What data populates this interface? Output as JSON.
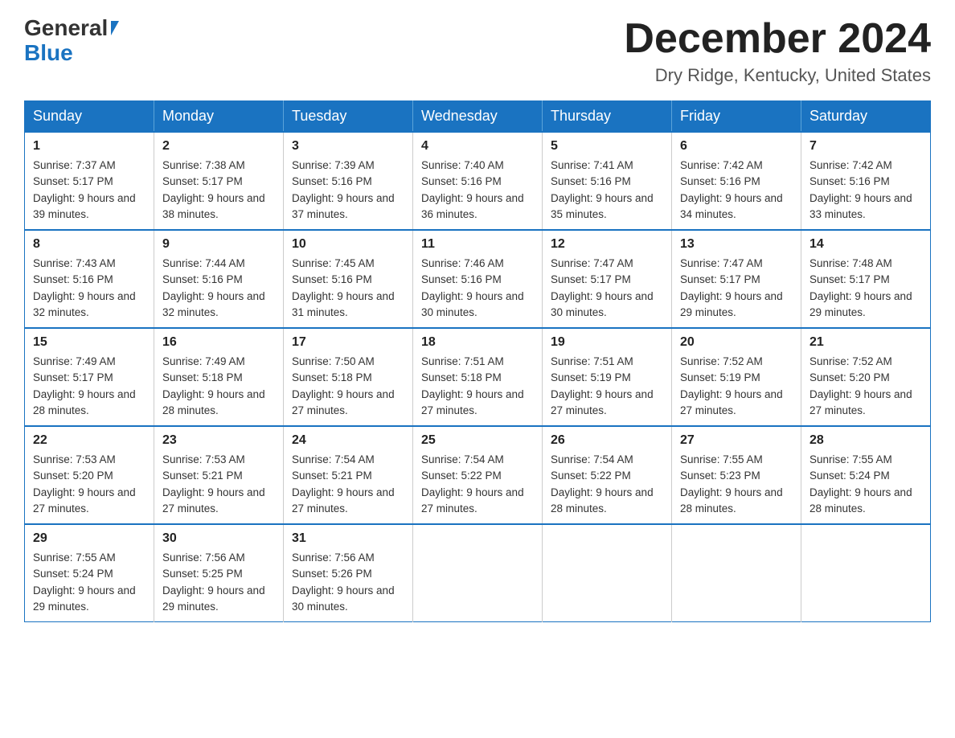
{
  "header": {
    "logo_general": "General",
    "logo_blue": "Blue",
    "month_title": "December 2024",
    "location": "Dry Ridge, Kentucky, United States"
  },
  "days_of_week": [
    "Sunday",
    "Monday",
    "Tuesday",
    "Wednesday",
    "Thursday",
    "Friday",
    "Saturday"
  ],
  "weeks": [
    [
      {
        "day": "1",
        "sunrise": "7:37 AM",
        "sunset": "5:17 PM",
        "daylight": "9 hours and 39 minutes."
      },
      {
        "day": "2",
        "sunrise": "7:38 AM",
        "sunset": "5:17 PM",
        "daylight": "9 hours and 38 minutes."
      },
      {
        "day": "3",
        "sunrise": "7:39 AM",
        "sunset": "5:16 PM",
        "daylight": "9 hours and 37 minutes."
      },
      {
        "day": "4",
        "sunrise": "7:40 AM",
        "sunset": "5:16 PM",
        "daylight": "9 hours and 36 minutes."
      },
      {
        "day": "5",
        "sunrise": "7:41 AM",
        "sunset": "5:16 PM",
        "daylight": "9 hours and 35 minutes."
      },
      {
        "day": "6",
        "sunrise": "7:42 AM",
        "sunset": "5:16 PM",
        "daylight": "9 hours and 34 minutes."
      },
      {
        "day": "7",
        "sunrise": "7:42 AM",
        "sunset": "5:16 PM",
        "daylight": "9 hours and 33 minutes."
      }
    ],
    [
      {
        "day": "8",
        "sunrise": "7:43 AM",
        "sunset": "5:16 PM",
        "daylight": "9 hours and 32 minutes."
      },
      {
        "day": "9",
        "sunrise": "7:44 AM",
        "sunset": "5:16 PM",
        "daylight": "9 hours and 32 minutes."
      },
      {
        "day": "10",
        "sunrise": "7:45 AM",
        "sunset": "5:16 PM",
        "daylight": "9 hours and 31 minutes."
      },
      {
        "day": "11",
        "sunrise": "7:46 AM",
        "sunset": "5:16 PM",
        "daylight": "9 hours and 30 minutes."
      },
      {
        "day": "12",
        "sunrise": "7:47 AM",
        "sunset": "5:17 PM",
        "daylight": "9 hours and 30 minutes."
      },
      {
        "day": "13",
        "sunrise": "7:47 AM",
        "sunset": "5:17 PM",
        "daylight": "9 hours and 29 minutes."
      },
      {
        "day": "14",
        "sunrise": "7:48 AM",
        "sunset": "5:17 PM",
        "daylight": "9 hours and 29 minutes."
      }
    ],
    [
      {
        "day": "15",
        "sunrise": "7:49 AM",
        "sunset": "5:17 PM",
        "daylight": "9 hours and 28 minutes."
      },
      {
        "day": "16",
        "sunrise": "7:49 AM",
        "sunset": "5:18 PM",
        "daylight": "9 hours and 28 minutes."
      },
      {
        "day": "17",
        "sunrise": "7:50 AM",
        "sunset": "5:18 PM",
        "daylight": "9 hours and 27 minutes."
      },
      {
        "day": "18",
        "sunrise": "7:51 AM",
        "sunset": "5:18 PM",
        "daylight": "9 hours and 27 minutes."
      },
      {
        "day": "19",
        "sunrise": "7:51 AM",
        "sunset": "5:19 PM",
        "daylight": "9 hours and 27 minutes."
      },
      {
        "day": "20",
        "sunrise": "7:52 AM",
        "sunset": "5:19 PM",
        "daylight": "9 hours and 27 minutes."
      },
      {
        "day": "21",
        "sunrise": "7:52 AM",
        "sunset": "5:20 PM",
        "daylight": "9 hours and 27 minutes."
      }
    ],
    [
      {
        "day": "22",
        "sunrise": "7:53 AM",
        "sunset": "5:20 PM",
        "daylight": "9 hours and 27 minutes."
      },
      {
        "day": "23",
        "sunrise": "7:53 AM",
        "sunset": "5:21 PM",
        "daylight": "9 hours and 27 minutes."
      },
      {
        "day": "24",
        "sunrise": "7:54 AM",
        "sunset": "5:21 PM",
        "daylight": "9 hours and 27 minutes."
      },
      {
        "day": "25",
        "sunrise": "7:54 AM",
        "sunset": "5:22 PM",
        "daylight": "9 hours and 27 minutes."
      },
      {
        "day": "26",
        "sunrise": "7:54 AM",
        "sunset": "5:22 PM",
        "daylight": "9 hours and 28 minutes."
      },
      {
        "day": "27",
        "sunrise": "7:55 AM",
        "sunset": "5:23 PM",
        "daylight": "9 hours and 28 minutes."
      },
      {
        "day": "28",
        "sunrise": "7:55 AM",
        "sunset": "5:24 PM",
        "daylight": "9 hours and 28 minutes."
      }
    ],
    [
      {
        "day": "29",
        "sunrise": "7:55 AM",
        "sunset": "5:24 PM",
        "daylight": "9 hours and 29 minutes."
      },
      {
        "day": "30",
        "sunrise": "7:56 AM",
        "sunset": "5:25 PM",
        "daylight": "9 hours and 29 minutes."
      },
      {
        "day": "31",
        "sunrise": "7:56 AM",
        "sunset": "5:26 PM",
        "daylight": "9 hours and 30 minutes."
      },
      null,
      null,
      null,
      null
    ]
  ],
  "labels": {
    "sunrise_prefix": "Sunrise: ",
    "sunset_prefix": "Sunset: ",
    "daylight_prefix": "Daylight: "
  }
}
